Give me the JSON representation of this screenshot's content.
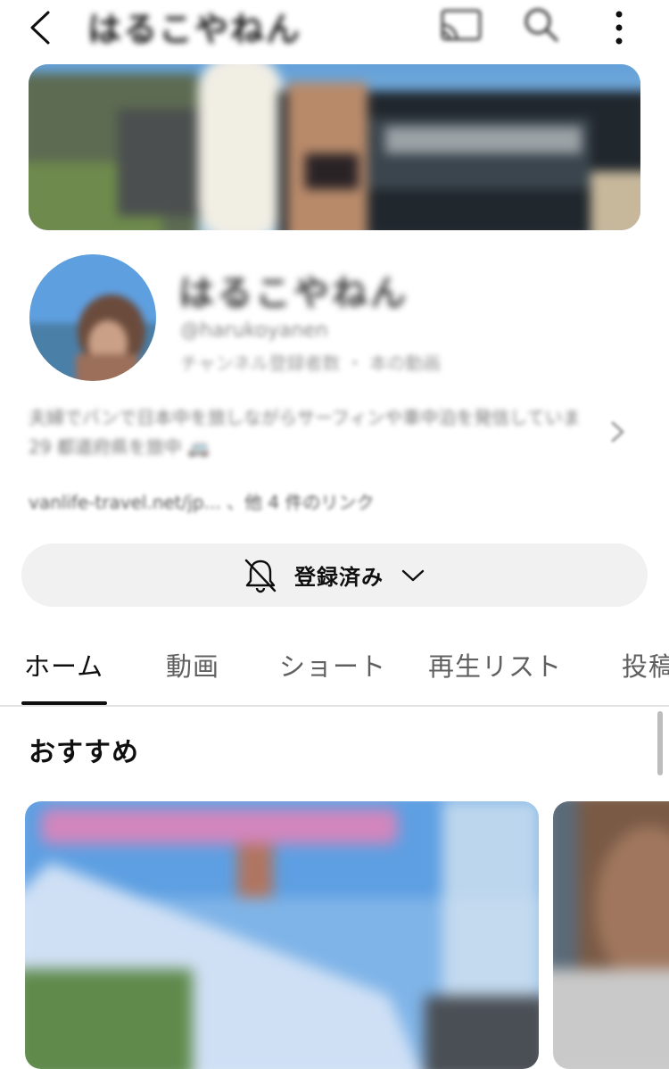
{
  "header": {
    "title": "はるこやねん",
    "back_icon": "chevron-left-icon",
    "cast_icon": "cast-icon",
    "search_icon": "search-icon",
    "more_icon": "more-vertical-icon"
  },
  "channel": {
    "name": "はるこやねん",
    "handle": "@harukoyanen",
    "stats": "チャンネル登録者数 ・ 本の動画",
    "description_line1": "夫婦でバンで日本中を旅しながらサーフィンや車中泊を発信しています",
    "description_line2": "29 都道府県を旅中 🚐",
    "links": "vanlife-travel.net/jp... 、他 4 件のリンク"
  },
  "subscribe": {
    "label": "登録済み",
    "bell_icon": "bell-off-icon",
    "dropdown_icon": "chevron-down-icon"
  },
  "tabs": [
    {
      "label": "ホーム",
      "active": true
    },
    {
      "label": "動画",
      "active": false
    },
    {
      "label": "ショート",
      "active": false
    },
    {
      "label": "再生リスト",
      "active": false
    },
    {
      "label": "投稿",
      "active": false
    }
  ],
  "section": {
    "title": "おすすめ"
  },
  "colors": {
    "background": "#ffffff",
    "text": "#0f0f0f",
    "secondary_text": "#606060",
    "subscribe_bg": "#f1f1f1"
  }
}
